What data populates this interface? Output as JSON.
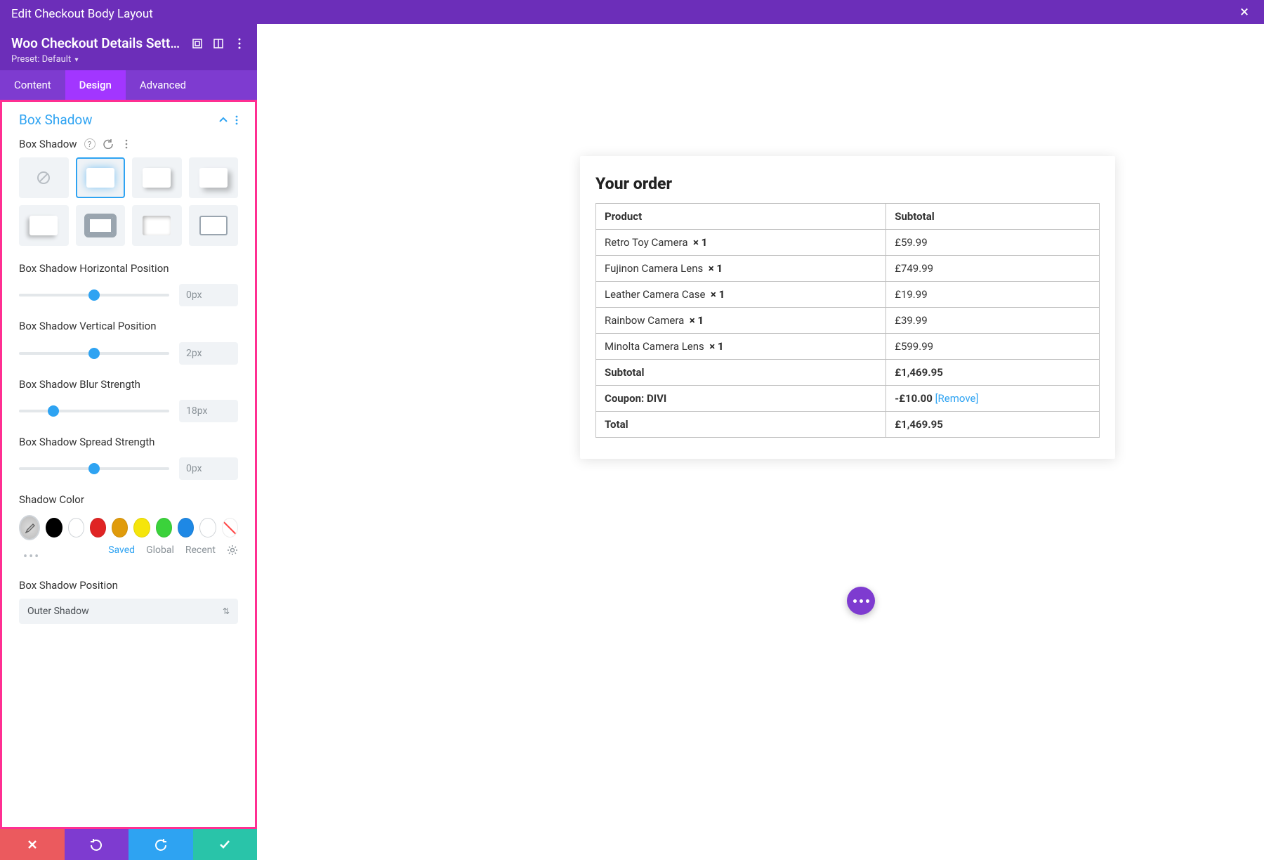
{
  "header": {
    "title": "Edit Checkout Body Layout"
  },
  "module": {
    "title": "Woo Checkout Details Setti...",
    "preset_label": "Preset:",
    "preset_value": "Default"
  },
  "tabs": {
    "content": "Content",
    "design": "Design",
    "advanced": "Advanced"
  },
  "section": {
    "title": "Box Shadow"
  },
  "box_shadow_label": "Box Shadow",
  "sliders": {
    "h_pos": {
      "label": "Box Shadow Horizontal Position",
      "value": "0px",
      "pct": 50
    },
    "v_pos": {
      "label": "Box Shadow Vertical Position",
      "value": "2px",
      "pct": 50
    },
    "blur": {
      "label": "Box Shadow Blur Strength",
      "value": "18px",
      "pct": 23
    },
    "spread": {
      "label": "Box Shadow Spread Strength",
      "value": "0px",
      "pct": 50
    }
  },
  "shadow_color": {
    "label": "Shadow Color",
    "swatches": [
      "#000000",
      "#ffffff",
      "#e02424",
      "#e09b0b",
      "#f5e50b",
      "#3bd23b",
      "#1e88e5",
      "#ffffff"
    ],
    "tabs": {
      "saved": "Saved",
      "global": "Global",
      "recent": "Recent"
    }
  },
  "shadow_position": {
    "label": "Box Shadow Position",
    "value": "Outer Shadow"
  },
  "order": {
    "heading": "Your order",
    "col_product": "Product",
    "col_subtotal": "Subtotal",
    "items": [
      {
        "name": "Retro Toy Camera",
        "qty": "1",
        "price": "£59.99"
      },
      {
        "name": "Fujinon Camera Lens",
        "qty": "1",
        "price": "£749.99"
      },
      {
        "name": "Leather Camera Case",
        "qty": "1",
        "price": "£19.99"
      },
      {
        "name": "Rainbow Camera",
        "qty": "1",
        "price": "£39.99"
      },
      {
        "name": "Minolta Camera Lens",
        "qty": "1",
        "price": "£599.99"
      }
    ],
    "subtotal_label": "Subtotal",
    "subtotal_value": "£1,469.95",
    "coupon_label": "Coupon: DIVI",
    "coupon_value": "-£10.00",
    "coupon_remove": "[Remove]",
    "total_label": "Total",
    "total_value": "£1,469.95"
  }
}
